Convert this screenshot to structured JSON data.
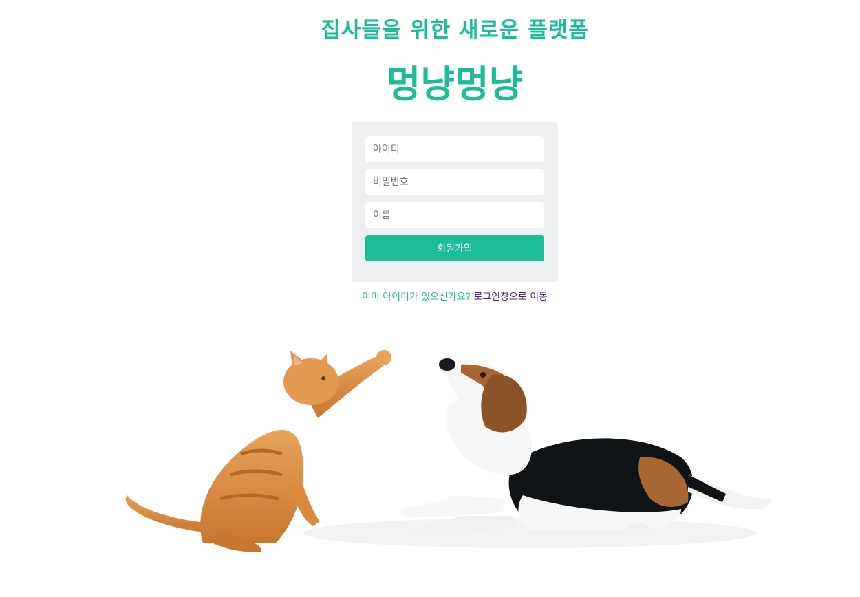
{
  "header": {
    "subtitle": "집사들을 위한 새로운 플랫폼",
    "brand": "멍냥멍냥"
  },
  "signup_form": {
    "id_placeholder": "아이디",
    "password_placeholder": "비밀번호",
    "name_placeholder": "이름",
    "submit_label": "회원가입"
  },
  "login_prompt": {
    "question": "이미 아이디가 있으신가요?",
    "link_label": "로그인창으로 이동"
  },
  "colors": {
    "accent": "#1cbc98",
    "form_background": "#eeeff1",
    "link": "#4a1f6e"
  }
}
